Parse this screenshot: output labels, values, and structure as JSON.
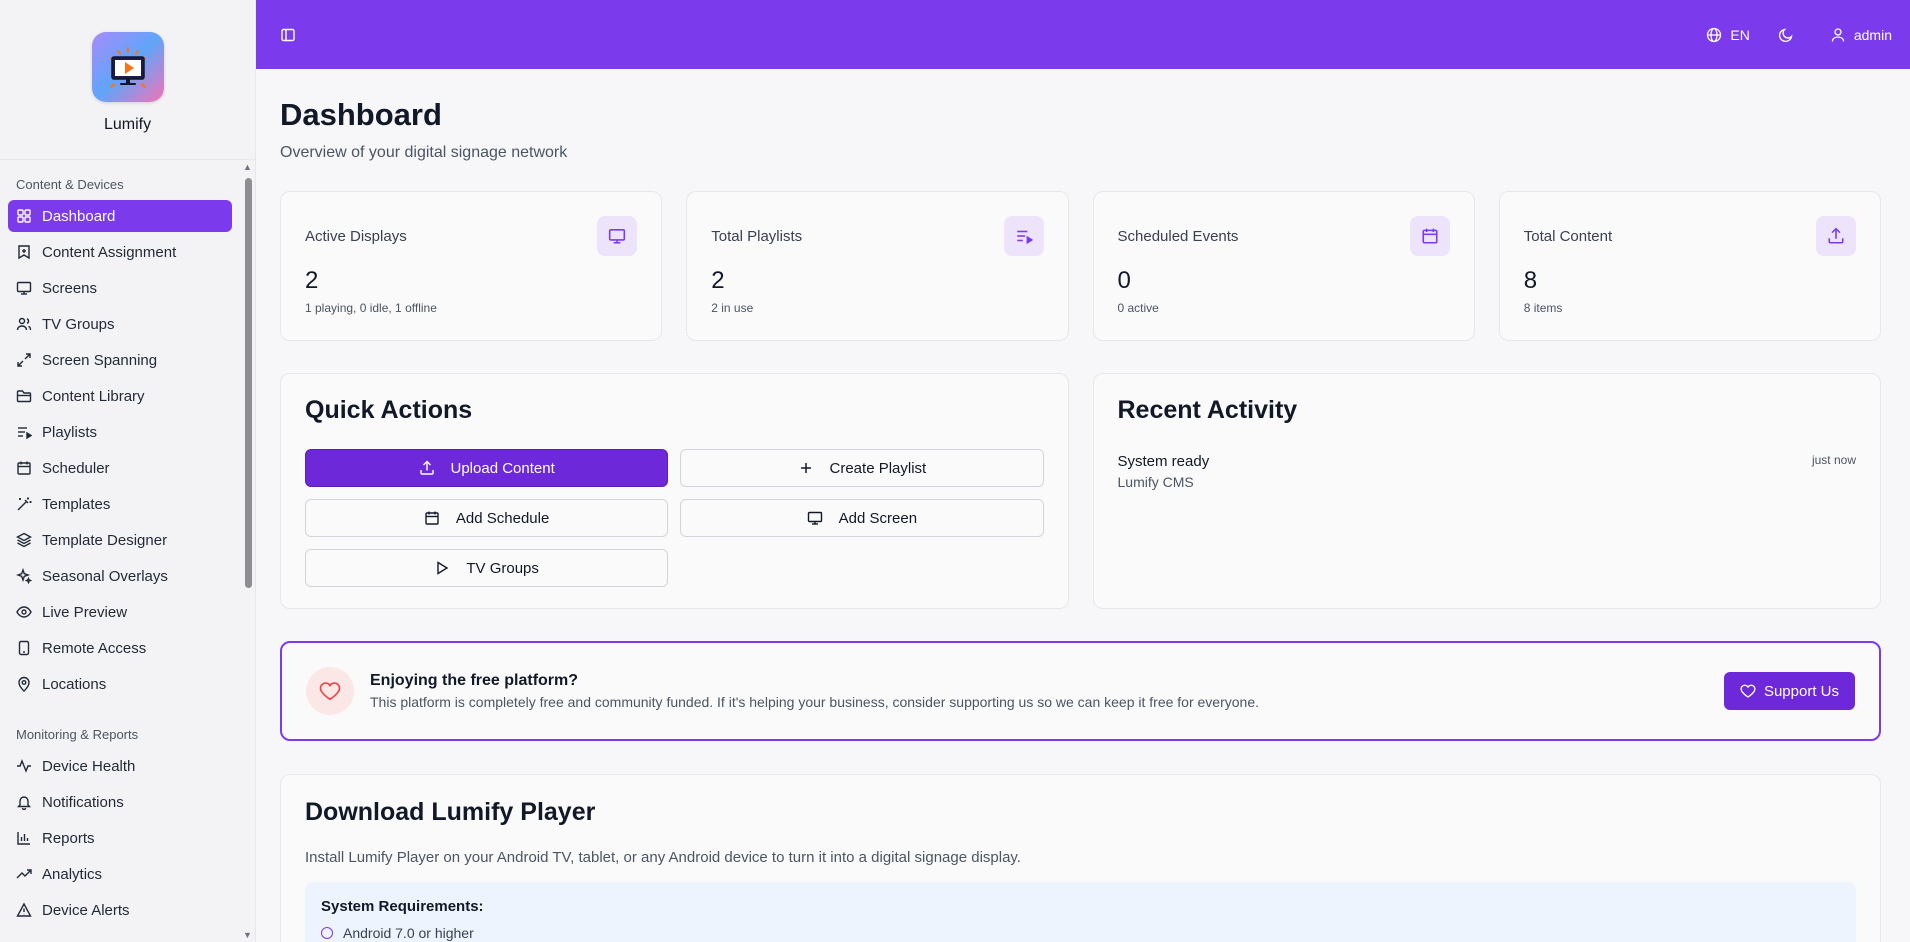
{
  "app": {
    "name": "Lumify"
  },
  "topbar": {
    "language": "EN",
    "user": "admin"
  },
  "sidebar": {
    "sections": [
      {
        "title": "Content & Devices",
        "items": [
          {
            "label": "Dashboard",
            "icon": "dashboard-icon",
            "active": true
          },
          {
            "label": "Content Assignment",
            "icon": "bookmark-icon"
          },
          {
            "label": "Screens",
            "icon": "monitor-icon"
          },
          {
            "label": "TV Groups",
            "icon": "users-icon"
          },
          {
            "label": "Screen Spanning",
            "icon": "expand-icon"
          },
          {
            "label": "Content Library",
            "icon": "folder-icon"
          },
          {
            "label": "Playlists",
            "icon": "playlist-icon"
          },
          {
            "label": "Scheduler",
            "icon": "calendar-icon"
          },
          {
            "label": "Templates",
            "icon": "wand-icon"
          },
          {
            "label": "Template Designer",
            "icon": "layers-icon"
          },
          {
            "label": "Seasonal Overlays",
            "icon": "sparkles-icon"
          },
          {
            "label": "Live Preview",
            "icon": "eye-icon"
          },
          {
            "label": "Remote Access",
            "icon": "tablet-icon"
          },
          {
            "label": "Locations",
            "icon": "map-pin-icon"
          }
        ]
      },
      {
        "title": "Monitoring & Reports",
        "items": [
          {
            "label": "Device Health",
            "icon": "activity-icon"
          },
          {
            "label": "Notifications",
            "icon": "bell-icon"
          },
          {
            "label": "Reports",
            "icon": "bar-chart-icon"
          },
          {
            "label": "Analytics",
            "icon": "trending-up-icon"
          },
          {
            "label": "Device Alerts",
            "icon": "alert-triangle-icon"
          }
        ]
      }
    ]
  },
  "page": {
    "title": "Dashboard",
    "subtitle": "Overview of your digital signage network"
  },
  "stats": [
    {
      "label": "Active Displays",
      "value": "2",
      "sub": "1 playing, 0 idle, 1 offline",
      "icon": "monitor-icon"
    },
    {
      "label": "Total Playlists",
      "value": "2",
      "sub": "2 in use",
      "icon": "playlist-icon"
    },
    {
      "label": "Scheduled Events",
      "value": "0",
      "sub": "0 active",
      "icon": "calendar-icon"
    },
    {
      "label": "Total Content",
      "value": "8",
      "sub": "8 items",
      "icon": "upload-icon"
    }
  ],
  "quick_actions": {
    "title": "Quick Actions",
    "buttons": [
      {
        "label": "Upload Content",
        "icon": "upload-icon",
        "primary": true
      },
      {
        "label": "Create Playlist",
        "icon": "plus-icon"
      },
      {
        "label": "Add Schedule",
        "icon": "calendar-icon"
      },
      {
        "label": "Add Screen",
        "icon": "monitor-icon"
      },
      {
        "label": "TV Groups",
        "icon": "play-icon"
      }
    ]
  },
  "recent_activity": {
    "title": "Recent Activity",
    "items": [
      {
        "title": "System ready",
        "sub": "Lumify CMS",
        "time": "just now"
      }
    ]
  },
  "support": {
    "title": "Enjoying the free platform?",
    "description": "This platform is completely free and community funded. If it's helping your business, consider supporting us so we can keep it free for everyone.",
    "button": "Support Us"
  },
  "download": {
    "title": "Download Lumify Player",
    "description": "Install Lumify Player on your Android TV, tablet, or any Android device to turn it into a digital signage display.",
    "requirements_title": "System Requirements:",
    "requirements": [
      "Android 7.0 or higher"
    ]
  },
  "colors": {
    "accent": "#7c3aed",
    "primary_button": "#6d28d9",
    "icon_bg": "#ede4fb"
  }
}
